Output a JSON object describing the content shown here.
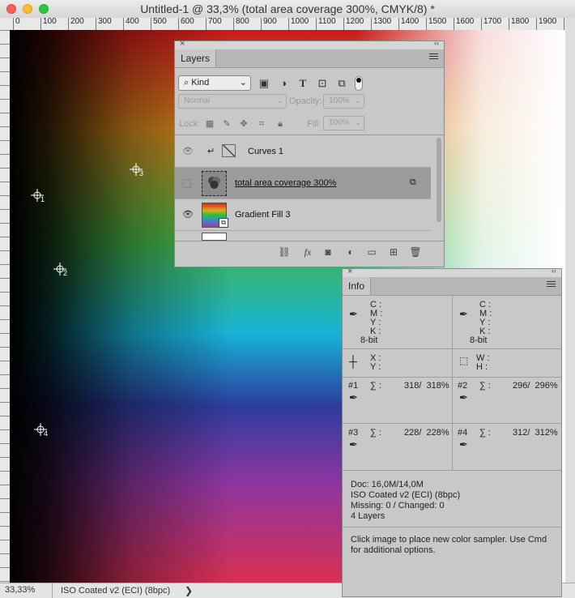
{
  "window": {
    "title": "Untitled-1 @ 33,3% (total area coverage 300%, CMYK/8) *"
  },
  "ruler": {
    "marks": [
      "0",
      "100",
      "200",
      "300",
      "400",
      "500",
      "600",
      "700",
      "800",
      "900",
      "1000",
      "1100",
      "1200",
      "1300",
      "1400",
      "1500",
      "1600",
      "1700",
      "1800",
      "1900",
      "200"
    ]
  },
  "samplers": [
    {
      "label": "1"
    },
    {
      "label": "2"
    },
    {
      "label": "3"
    },
    {
      "label": "4"
    }
  ],
  "status": {
    "zoom": "33,33%",
    "profile": "ISO Coated v2 (ECI) (8bpc)",
    "chevron": "❯"
  },
  "layers_panel": {
    "tab": "Layers",
    "kind": "Kind",
    "blend_mode": "Normal",
    "opacity_label": "Opacity:",
    "opacity_value": "100%",
    "lock_label": "Lock:",
    "fill_label": "Fill:",
    "fill_value": "100%",
    "layers": [
      {
        "name": "Curves 1",
        "visible": true,
        "selected": false
      },
      {
        "name": "total area coverage 300%",
        "visible": false,
        "selected": true
      },
      {
        "name": "Gradient Fill 3",
        "visible": true,
        "selected": false
      }
    ],
    "fx": "fx"
  },
  "info_panel": {
    "tab": "Info",
    "cmyk_left": {
      "c": "C :",
      "m": "M :",
      "y": "Y :",
      "k": "K :",
      "bits": "8-bit"
    },
    "cmyk_right": {
      "c": "C :",
      "m": "M :",
      "y": "Y :",
      "k": "K :",
      "bits": "8-bit"
    },
    "xy": {
      "x": "X :",
      "y": "Y :"
    },
    "wh": {
      "w": "W :",
      "h": "H :"
    },
    "samplers": [
      {
        "id": "#1",
        "sigma": "∑ :",
        "value": "318/  318%"
      },
      {
        "id": "#2",
        "sigma": "∑ :",
        "value": "296/  296%"
      },
      {
        "id": "#3",
        "sigma": "∑ :",
        "value": "228/  228%"
      },
      {
        "id": "#4",
        "sigma": "∑ :",
        "value": "312/  312%"
      }
    ],
    "doc": "Doc: 16,0M/14,0M",
    "profile": "ISO Coated v2 (ECI) (8bpc)",
    "missing": "Missing: 0 / Changed: 0",
    "layers": "4 Layers",
    "hint": "Click image to place new color sampler.  Use Cmd for additional options."
  },
  "colors": {
    "close": "#fc5f57",
    "minimize": "#fdbc2e",
    "maximize": "#28c840"
  }
}
